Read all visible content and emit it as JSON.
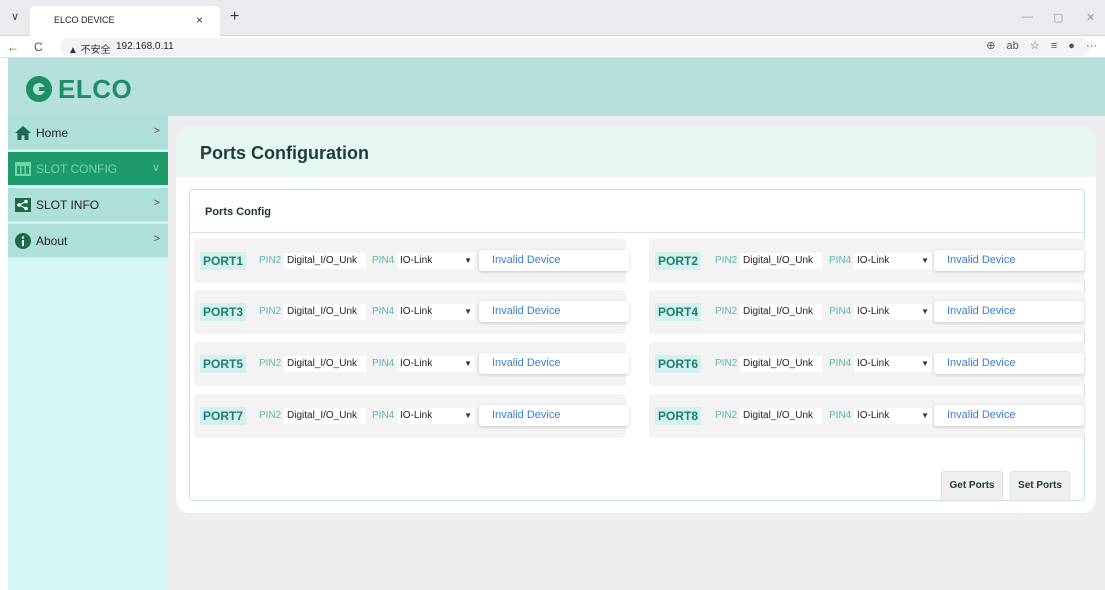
{
  "browser": {
    "tab_title": "ELCO DEVICE",
    "tab_close": "×",
    "new_tab": "+",
    "url_security": "▲ 不安全",
    "url": "192.168.0.11",
    "back": "←",
    "refresh": "C",
    "menu": "···"
  },
  "app": {
    "logo_text": "ELCO"
  },
  "sidebar": {
    "items": [
      {
        "label": "Home",
        "icon": "home-icon"
      },
      {
        "label": "SLOT CONFIG",
        "icon": "slot-config-icon"
      },
      {
        "label": "SLOT INFO",
        "icon": "share-icon"
      },
      {
        "label": "About",
        "icon": "info-icon"
      }
    ]
  },
  "colors": {
    "header": "#b5e0db",
    "sidebar": "#d4f7f6",
    "active_item": "#1f9a6c",
    "port_label": "#1b7e74",
    "status_text": "#3a7fd2"
  },
  "main": {
    "page_title": "Ports Configuration",
    "card_title": "Ports Config",
    "pin2_label": "PIN2",
    "pin4_label": "PIN4",
    "ports": [
      {
        "name": "PORT1",
        "pin2": "Digital_I/O_Unk",
        "pin4": "IO-Link",
        "status": "Invalid Device"
      },
      {
        "name": "PORT2",
        "pin2": "Digital_I/O_Unk",
        "pin4": "IO-Link",
        "status": "Invalid Device"
      },
      {
        "name": "PORT3",
        "pin2": "Digital_I/O_Unk",
        "pin4": "IO-Link",
        "status": "Invalid Device"
      },
      {
        "name": "PORT4",
        "pin2": "Digital_I/O_Unk",
        "pin4": "IO-Link",
        "status": "Invalid Device"
      },
      {
        "name": "PORT5",
        "pin2": "Digital_I/O_Unk",
        "pin4": "IO-Link",
        "status": "Invalid Device"
      },
      {
        "name": "PORT6",
        "pin2": "Digital_I/O_Unk",
        "pin4": "IO-Link",
        "status": "Invalid Device"
      },
      {
        "name": "PORT7",
        "pin2": "Digital_I/O_Unk",
        "pin4": "IO-Link",
        "status": "Invalid Device"
      },
      {
        "name": "PORT8",
        "pin2": "Digital_I/O_Unk",
        "pin4": "IO-Link",
        "status": "Invalid Device"
      }
    ],
    "get_ports_label": "Get Ports",
    "set_ports_label": "Set Ports"
  }
}
